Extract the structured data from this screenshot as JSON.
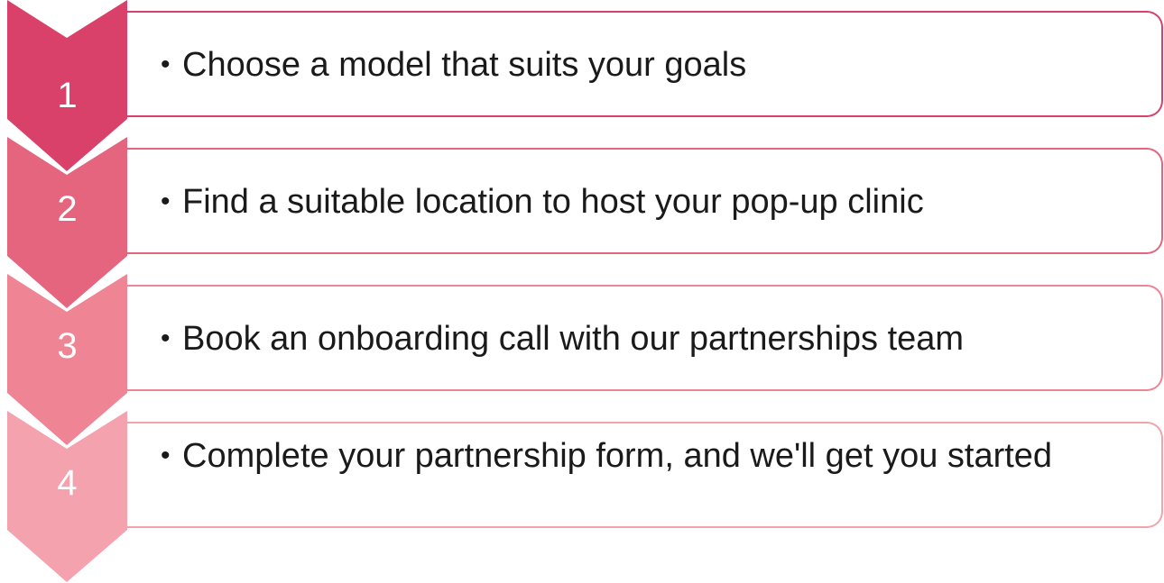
{
  "colors": {
    "step1": "#d9416a",
    "step2": "#e5647e",
    "step3": "#ee8494",
    "step4": "#f4a2ad",
    "text": "#1a1a1a"
  },
  "bullet_symbol": "•",
  "steps": [
    {
      "number": "1",
      "text": "Choose a model that suits your goals"
    },
    {
      "number": "2",
      "text": "Find a suitable location to host your pop-up clinic"
    },
    {
      "number": "3",
      "text": "Book an onboarding call with our partnerships team"
    },
    {
      "number": "4",
      "text": "Complete your partnership form, and we'll get you started"
    }
  ]
}
